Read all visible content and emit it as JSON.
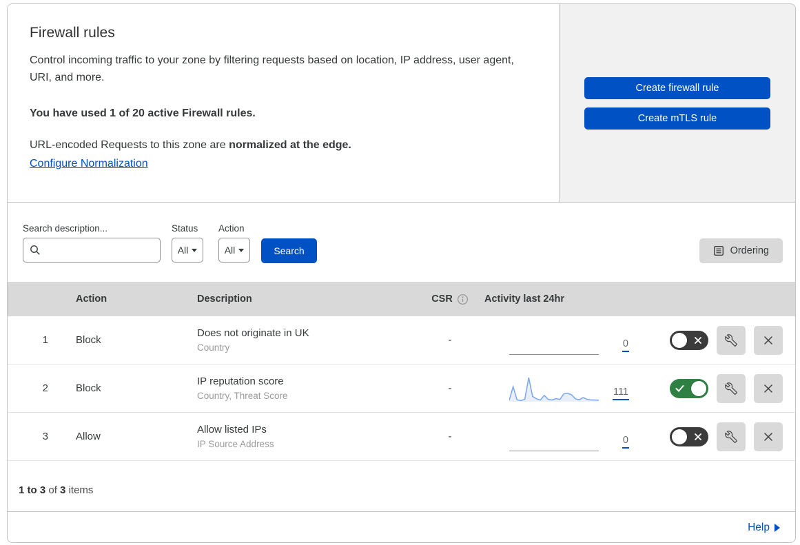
{
  "header": {
    "title": "Firewall rules",
    "description": "Control incoming traffic to your zone by filtering requests based on location, IP address, user agent, URI, and more.",
    "usage_note": "You have used 1 of 20 active Firewall rules.",
    "normalization_prefix": "URL-encoded Requests to this zone are ",
    "normalization_bold": "normalized at the edge.",
    "normalization_link": "Configure Normalization",
    "create_firewall_button": "Create firewall rule",
    "create_mtls_button": "Create mTLS rule"
  },
  "filters": {
    "search_label": "Search description...",
    "status_label": "Status",
    "status_value": "All",
    "action_label": "Action",
    "action_value": "All",
    "search_button": "Search",
    "ordering_button": "Ordering"
  },
  "table": {
    "headers": {
      "action": "Action",
      "description": "Description",
      "csr": "CSR",
      "activity": "Activity last 24hr"
    },
    "rows": [
      {
        "number": "1",
        "action": "Block",
        "description": "Does not originate in UK",
        "criteria": "Country",
        "csr": "-",
        "activity_count": "0",
        "enabled": false
      },
      {
        "number": "2",
        "action": "Block",
        "description": "IP reputation score",
        "criteria": "Country, Threat Score",
        "csr": "-",
        "activity_count": "111",
        "enabled": true
      },
      {
        "number": "3",
        "action": "Allow",
        "description": "Allow listed IPs",
        "criteria": "IP Source Address",
        "csr": "-",
        "activity_count": "0",
        "enabled": false
      }
    ]
  },
  "footer": {
    "range": "1 to 3",
    "of_text": "of",
    "total": "3",
    "items_text": "items",
    "help_link": "Help"
  },
  "colors": {
    "primary_blue": "#0051c3",
    "toggle_on_green": "#2e8043",
    "toggle_off_gray": "#3b3b3b",
    "sparkline_stroke": "#7aa7ea",
    "sparkline_fill": "rgba(130,167,234,0.18)",
    "table_header_bg": "#d9d9d9",
    "side_panel_bg": "#f1f1f2"
  },
  "chart_data": {
    "type": "line",
    "title": "Activity last 24hr — rule 2 (IP reputation score)",
    "total_requests": 111,
    "x": "last 24 hours (evenly spaced samples)",
    "values": [
      6,
      62,
      8,
      5,
      10,
      100,
      22,
      12,
      7,
      26,
      10,
      7,
      13,
      9,
      32,
      35,
      29,
      12,
      8,
      17,
      10,
      7,
      7,
      6
    ],
    "ylim": [
      0,
      100
    ],
    "grid": false,
    "legend": "none"
  }
}
